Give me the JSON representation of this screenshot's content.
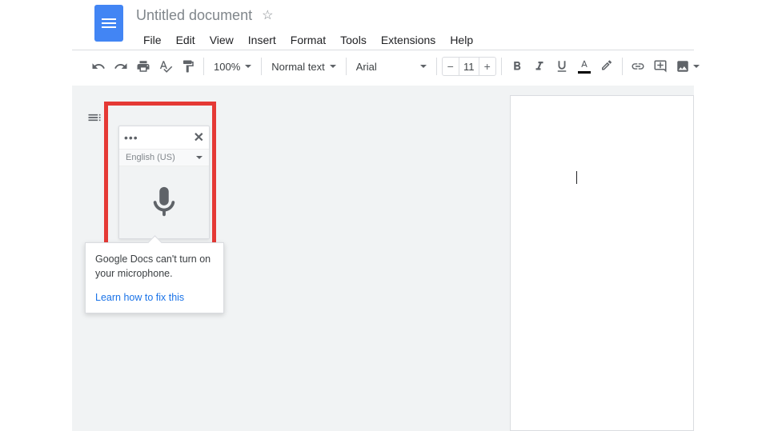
{
  "header": {
    "title": "Untitled document"
  },
  "menu": {
    "items": [
      "File",
      "Edit",
      "View",
      "Insert",
      "Format",
      "Tools",
      "Extensions",
      "Help"
    ]
  },
  "toolbar": {
    "zoom": "100%",
    "style": "Normal text",
    "font": "Arial",
    "font_size": "11",
    "minus": "−",
    "plus": "+"
  },
  "voice": {
    "dots": "•••",
    "close": "✕",
    "language": "English (US)"
  },
  "tooltip": {
    "message": "Google Docs can't turn on your microphone.",
    "link": "Learn how to fix this"
  }
}
